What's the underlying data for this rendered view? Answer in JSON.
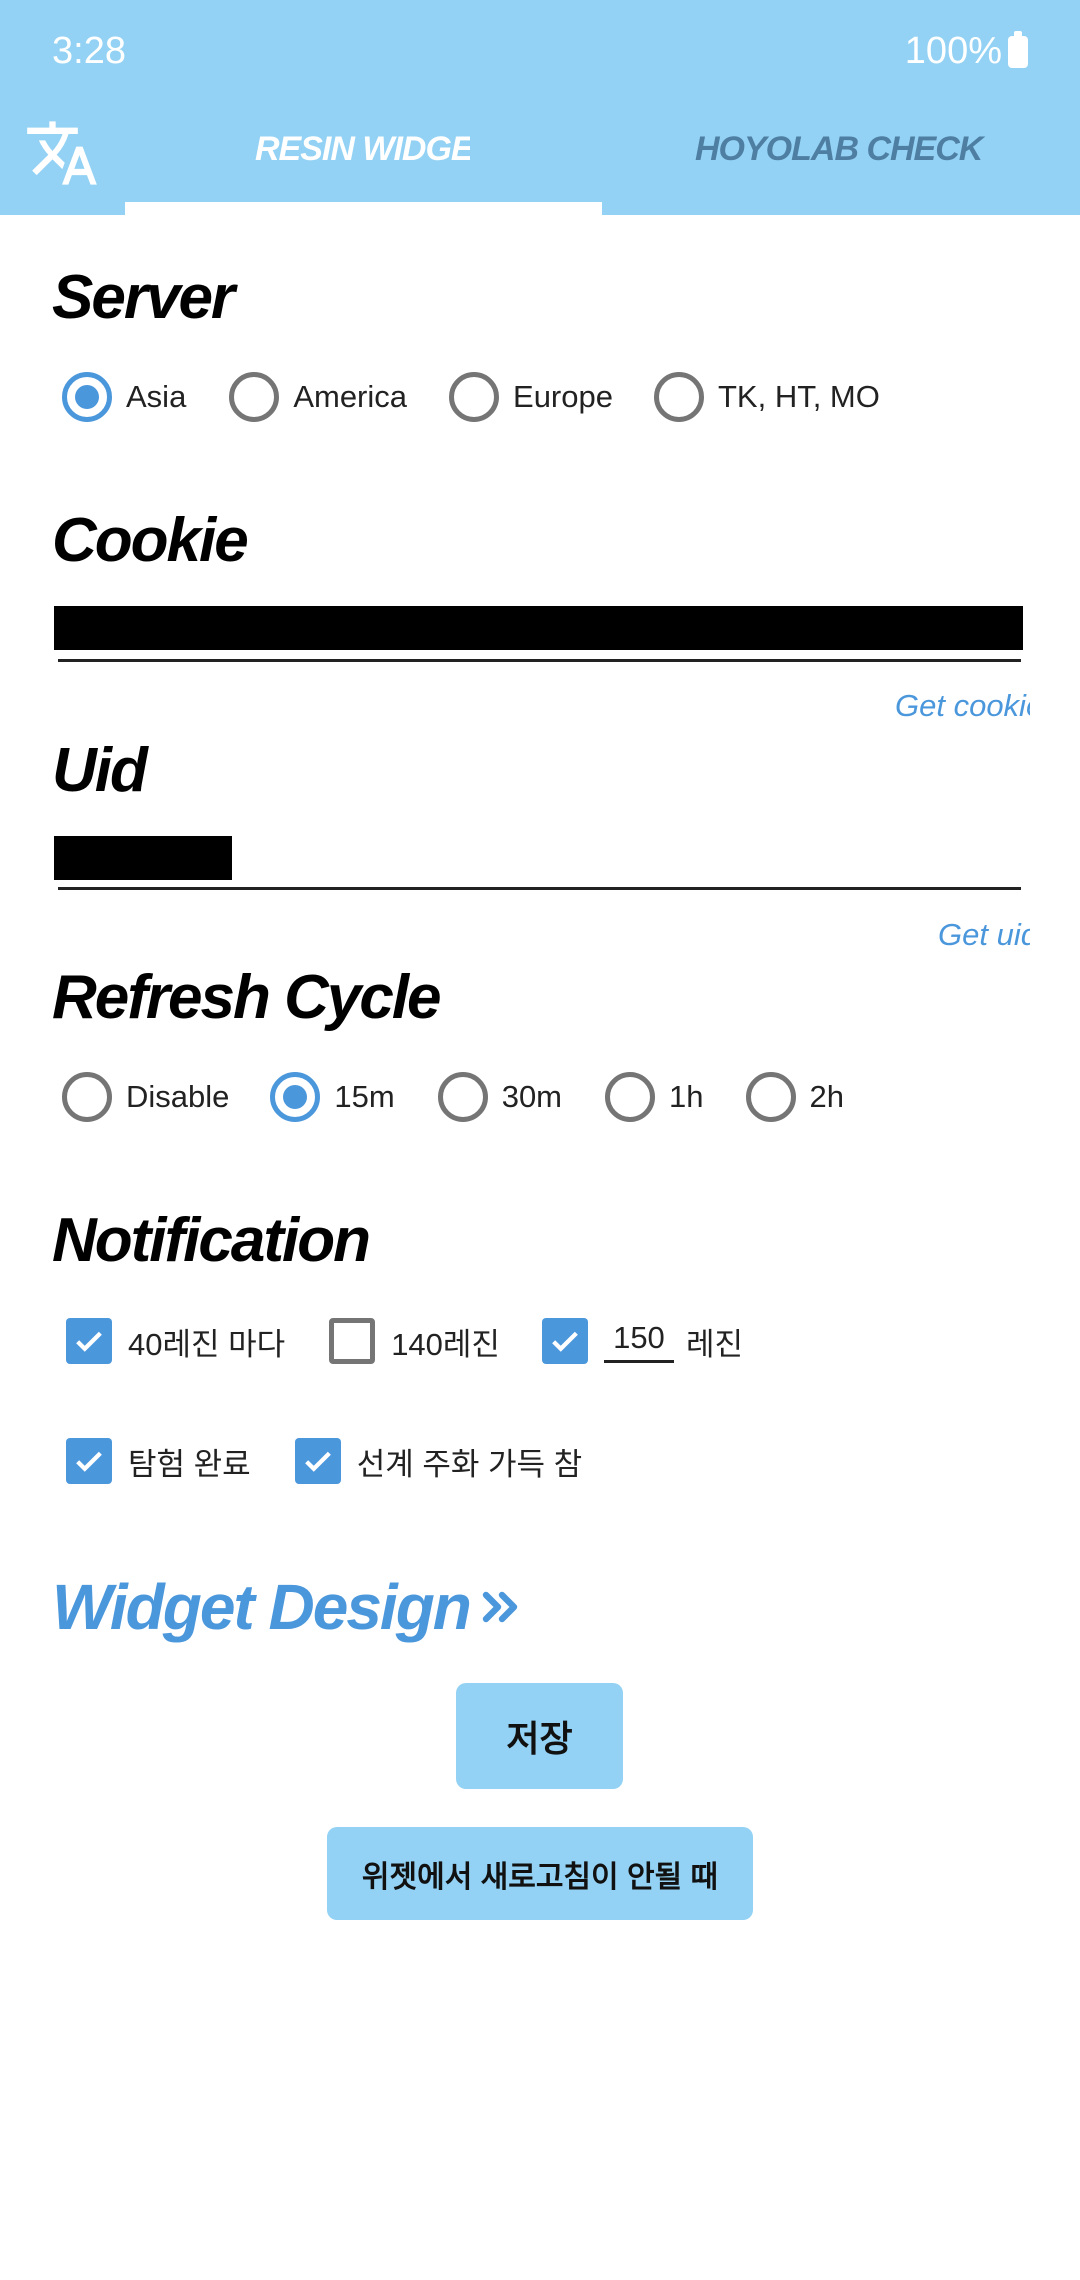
{
  "status_bar": {
    "time": "3:28",
    "battery": "100%"
  },
  "tabs": [
    {
      "label": "RESIN WIDGET"
    },
    {
      "label": "HOYOLAB CHECK IN"
    }
  ],
  "server": {
    "title": "Server",
    "options": [
      "Asia",
      "America",
      "Europe",
      "TK, HT, MO"
    ],
    "selected": "Asia"
  },
  "cookie": {
    "title": "Cookie",
    "link": "Get cookie"
  },
  "uid": {
    "title": "Uid",
    "link": "Get uid"
  },
  "refresh": {
    "title": "Refresh Cycle",
    "options": [
      "Disable",
      "15m",
      "30m",
      "1h",
      "2h"
    ],
    "selected": "15m"
  },
  "notification": {
    "title": "Notification",
    "items": [
      {
        "label": "40레진 마다",
        "checked": true
      },
      {
        "label": "140레진",
        "checked": false
      },
      {
        "value": "150",
        "suffix": "레진",
        "checked": true
      },
      {
        "label": "탐험 완료",
        "checked": true
      },
      {
        "label": "선계 주화 가득 참",
        "checked": true
      }
    ]
  },
  "widget_design": {
    "label": "Widget Design"
  },
  "buttons": {
    "save": "저장",
    "refresh_help": "위젯에서 새로고침이 안될 때"
  },
  "colors": {
    "header": "#93d2f4",
    "accent": "#4b97dc",
    "button": "#93d2f4"
  }
}
